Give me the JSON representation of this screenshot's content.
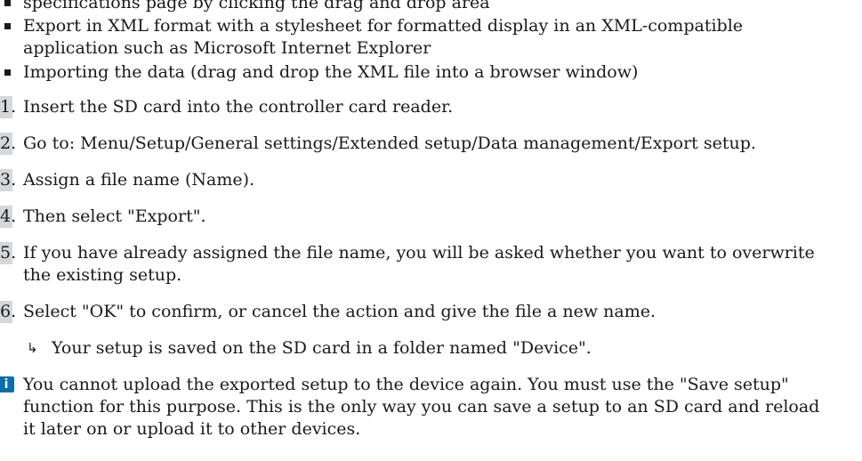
{
  "intro_partial": "specifications page by clicking the drag and drop area",
  "bullets": [
    "Export in XML format with a stylesheet for formatted display in an XML-compatible",
    "application such as Microsoft Internet Explorer",
    "Importing the data (drag and drop the XML file into a browser window)"
  ],
  "steps": [
    {
      "num": "1.",
      "text": "Insert the SD card into the controller card reader."
    },
    {
      "num": "2.",
      "text": "Go to: Menu/Setup/General settings/Extended setup/Data management/Export setup."
    },
    {
      "num": "3.",
      "text": "Assign a file name (Name)."
    },
    {
      "num": "4.",
      "text": "Then select \"Export\"."
    },
    {
      "num": "5.",
      "text": "If you have already assigned the file name, you will be asked whether you want to overwrite",
      "text2": "the existing setup."
    },
    {
      "num": "6.",
      "text": "Select \"OK\" to confirm, or cancel the action and give the file a new name."
    }
  ],
  "result": {
    "arrow": "↳",
    "text": "Your setup is saved on the SD card in a folder named \"Device\"."
  },
  "note": {
    "icon": "info-icon",
    "lines": [
      "You cannot upload the exported setup to the device again. You must use the \"Save setup\"",
      "function for this purpose. This is the only way you can save a setup to an SD card and reload",
      "it later on or upload it to other devices."
    ]
  },
  "colors": {
    "step_number_bg": "#d4d8db",
    "info_icon_bg": "#0a6fa8",
    "text": "#1a1a1a"
  }
}
